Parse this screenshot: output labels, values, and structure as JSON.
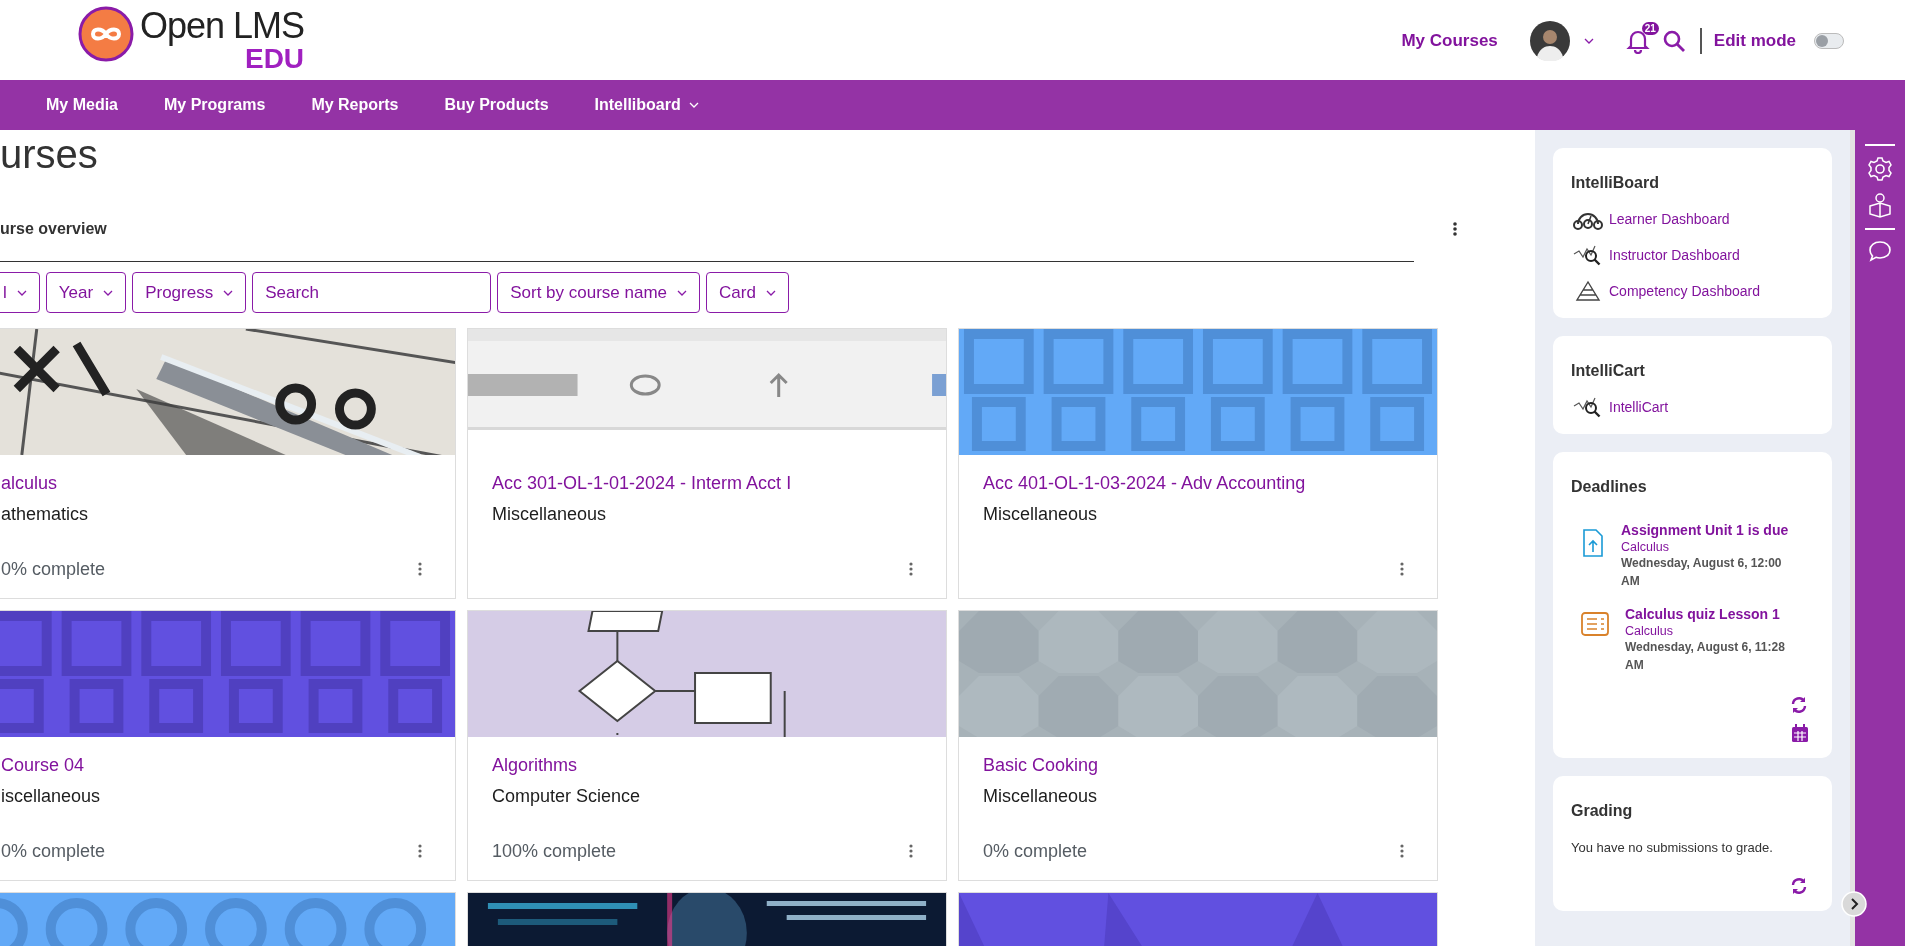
{
  "logo": {
    "name": "Open LMS",
    "edition": "EDU"
  },
  "header": {
    "my_courses": "My Courses",
    "notifications": "21",
    "edit_mode": {
      "label": "Edit mode",
      "on": false
    }
  },
  "nav": [
    {
      "label": "My Media",
      "dropdown": false
    },
    {
      "label": "My Programs",
      "dropdown": false
    },
    {
      "label": "My Reports",
      "dropdown": false
    },
    {
      "label": "Buy Products",
      "dropdown": false
    },
    {
      "label": "Intelliboard",
      "dropdown": true
    }
  ],
  "page_title": "urses",
  "overview": {
    "title": "urse overview",
    "filters": [
      {
        "kind": "dropdown",
        "label": "l"
      },
      {
        "kind": "dropdown",
        "label": "Year"
      },
      {
        "kind": "dropdown",
        "label": "Progress"
      },
      {
        "kind": "search",
        "placeholder": "Search"
      },
      {
        "kind": "dropdown",
        "label": "Sort by course name"
      },
      {
        "kind": "dropdown",
        "label": "Card"
      }
    ],
    "courses": [
      {
        "image": {
          "kind": "picture"
        },
        "title": "alculus",
        "category": "athematics",
        "progress": "0% complete"
      },
      {
        "image": {
          "kind": "picture"
        },
        "title": "Acc 301-OL-1-01-2024 - Interm Acct I",
        "category": "Miscellaneous"
      },
      {
        "image": {
          "kind": "picture"
        },
        "title": "Acc 401-OL-1-03-2024 - Adv Accounting",
        "category": "Miscellaneous"
      },
      {
        "image": {
          "kind": "picture"
        },
        "title": "Course 04",
        "category": "iscellaneous",
        "progress": "0% complete"
      },
      {
        "image": {
          "kind": "picture"
        },
        "title": "Algorithms",
        "category": "Computer Science",
        "progress": "100% complete"
      },
      {
        "image": {
          "kind": "picture"
        },
        "title": "Basic Cooking",
        "category": "Miscellaneous",
        "progress": "0% complete"
      },
      {
        "image": {
          "kind": "picture"
        }
      },
      {
        "image": {
          "kind": "picture"
        }
      },
      {
        "image": {
          "kind": "picture"
        }
      }
    ]
  },
  "blocks": [
    {
      "kind": "links",
      "title": "IntelliBoard",
      "links": [
        "Learner Dashboard",
        "Instructor Dashboard",
        "Competency Dashboard"
      ]
    },
    {
      "kind": "links",
      "title": "IntelliCart",
      "links": [
        "IntelliCart"
      ]
    },
    {
      "kind": "deadlines",
      "title": "Deadlines",
      "items": [
        {
          "kind": "assignment",
          "title": "Assignment Unit 1 is due",
          "course": "Calculus",
          "date": "Wednesday, August 6, 12:00 AM"
        },
        {
          "kind": "quiz",
          "title": "Calculus quiz Lesson 1",
          "course": "Calculus",
          "date": "Wednesday, August 6, 11:28 AM"
        }
      ]
    },
    {
      "kind": "text",
      "title": "Grading",
      "text": "You have no submissions to grade."
    }
  ]
}
